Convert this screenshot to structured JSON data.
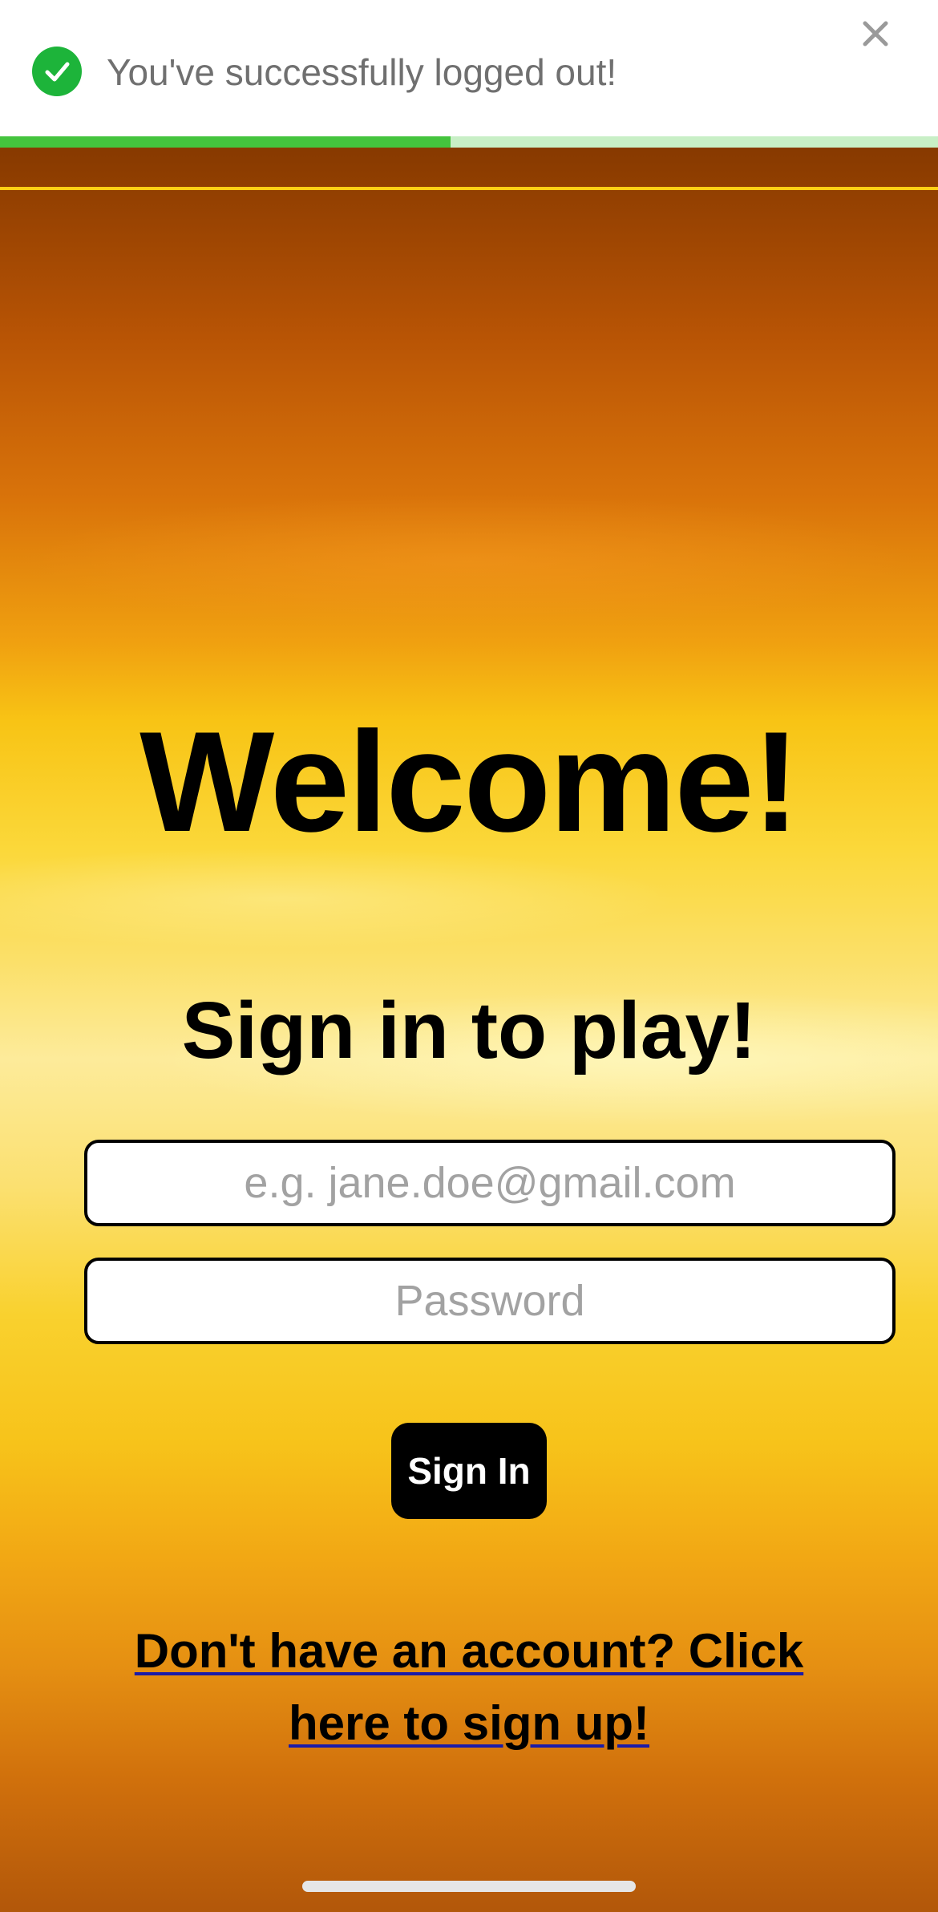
{
  "toast": {
    "message": "You've successfully logged out!",
    "icon": "check-circle-icon",
    "close_icon": "close-icon",
    "progress": 0.48,
    "colors": {
      "success": "#1db43a",
      "progress_fill": "#44c43d",
      "progress_track": "#c8efc6"
    }
  },
  "main": {
    "heading": "Welcome!",
    "subtitle": "Sign in to play!",
    "email": {
      "placeholder": "e.g. jane.doe@gmail.com",
      "value": ""
    },
    "password": {
      "placeholder": "Password",
      "value": ""
    },
    "signin_label": "Sign In",
    "signup_link": "Don't have an account? Click here to sign up!"
  },
  "colors": {
    "accent": "#ffcf14",
    "button": "#000000"
  }
}
